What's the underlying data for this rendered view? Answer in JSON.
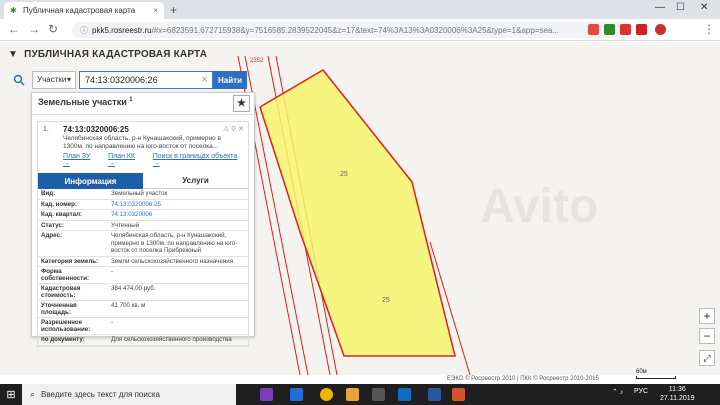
{
  "browser": {
    "tab_title": "Публичная кадастровая карта",
    "tab_close": "×",
    "new_tab": "+",
    "url_host": "pkk5.rosreestr.ru",
    "url_rest": "/#x=6823591.672715938&y=7516585.2839522045&z=17&text=74%3A13%3A0320006%3A25&type=1&app=sea...",
    "lock_glyph": "ⓘ",
    "back": "←",
    "forward": "→",
    "reload": "↻",
    "minimize": "—",
    "maximize": "☐",
    "close": "✕"
  },
  "app": {
    "title": "ПУБЛИЧНАЯ КАДАСТРОВАЯ КАРТА",
    "search": {
      "type": "Участки",
      "value": "74:13:0320006:26",
      "button": "Найти"
    }
  },
  "panel": {
    "title": "Земельные участки",
    "count": "1",
    "item": {
      "num": "1.",
      "cadastral": "74:13:0320006:25",
      "description": "Челябинская область, р-н Кунашакский, примерно в 1300м. по направлению на юго-восток от поселка...",
      "links": [
        "План ЗУ →",
        "План КК →",
        "Поиск в границах объекта →"
      ],
      "tabs": [
        "Информация",
        "Услуги"
      ],
      "props": [
        {
          "k": "Вид:",
          "v": "Земельный участок",
          "link": false
        },
        {
          "k": "Кад. номер:",
          "v": "74:13:0320006:25",
          "link": true
        },
        {
          "k": "Кад. квартал:",
          "v": "74:13:0320006",
          "link": true
        },
        {
          "k": "Статус:",
          "v": "Учтенный",
          "link": false
        },
        {
          "k": "Адрес:",
          "v": "Челябинская область, р-н Кунашакский, примерно в 1300м. по направлению на юго-восток от поселка Прибрежный",
          "link": false
        },
        {
          "k": "Категория земель:",
          "v": "Земли сельскохозяйственного назначения",
          "link": false
        },
        {
          "k": "Форма собственности:",
          "v": "-",
          "link": false
        },
        {
          "k": "Кадастровая стоимость:",
          "v": "384 474,00 руб.",
          "link": false
        },
        {
          "k": "Уточненная площадь:",
          "v": "41 700 кв. м",
          "link": false
        },
        {
          "k": "Разрешенное использование:",
          "v": "-",
          "link": false
        },
        {
          "k": "по документу:",
          "v": "Для сельскохозяйственного производства",
          "link": false
        }
      ]
    }
  },
  "map": {
    "label_top": "2352",
    "parcel_label_1": "25",
    "parcel_label_2": "25",
    "watermark": "Avito",
    "copyright": "ЕЭКО © Росреестр 2010 | ПКК © Росреестр 2010-2015",
    "scale": "60м",
    "zoom_in": "+",
    "zoom_out": "−",
    "parcel_fill": "#f5f56b",
    "parcel_stroke": "#e0201f"
  },
  "taskbar": {
    "search_placeholder": "Введите здесь текст для поиска",
    "lang": "РУС",
    "time": "11:36",
    "date": "27.11.2019"
  }
}
